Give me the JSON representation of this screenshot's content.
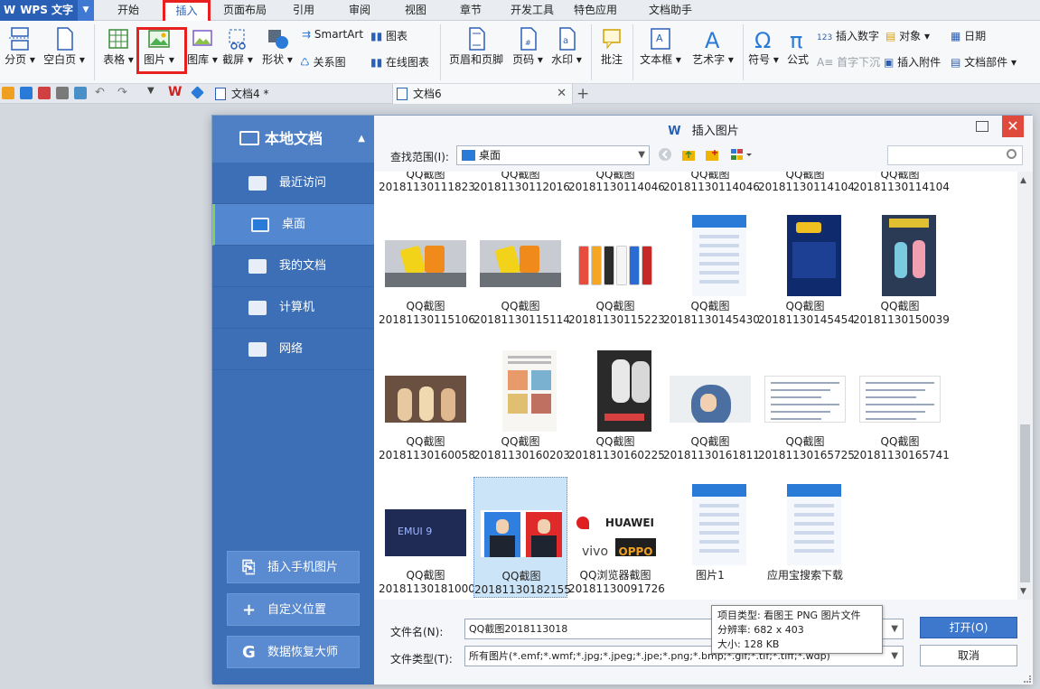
{
  "app": {
    "logo": "WPS 文字"
  },
  "menu": [
    {
      "label": "开始",
      "active": false
    },
    {
      "label": "插入",
      "active": true
    },
    {
      "label": "页面布局",
      "active": false
    },
    {
      "label": "引用",
      "active": false
    },
    {
      "label": "审阅",
      "active": false
    },
    {
      "label": "视图",
      "active": false
    },
    {
      "label": "章节",
      "active": false
    },
    {
      "label": "开发工具",
      "active": false
    },
    {
      "label": "特色应用",
      "active": false
    },
    {
      "label": "文档助手",
      "active": false
    }
  ],
  "ribbon": {
    "page_break": "分页",
    "blank_page": "空白页",
    "table": "表格",
    "picture": "图片",
    "gallery": "图库",
    "screenshot": "截屏",
    "shape": "形状",
    "smartart": "SmartArt",
    "chart": "图表",
    "relation_chart": "关系图",
    "online_chart": "在线图表",
    "header_footer": "页眉和页脚",
    "page_number": "页码",
    "watermark": "水印",
    "comment": "批注",
    "textbox": "文本框",
    "wordart": "艺术字",
    "symbol": "符号",
    "formula": "公式",
    "insert_number": "插入数字",
    "object": "对象",
    "date": "日期",
    "drop_cap": "首字下沉",
    "attachment": "插入附件",
    "doc_parts": "文档部件"
  },
  "doc_tabs": [
    {
      "label": "文档4 *",
      "active": false
    },
    {
      "label": "文档6",
      "active": true
    }
  ],
  "dialog": {
    "title": "插入图片",
    "side_header": "本地文档",
    "side_items": [
      {
        "label": "最近访问",
        "selected": false
      },
      {
        "label": "桌面",
        "selected": true
      },
      {
        "label": "我的文档",
        "selected": false
      },
      {
        "label": "计算机",
        "selected": false
      },
      {
        "label": "网络",
        "selected": false
      }
    ],
    "side_buttons": [
      {
        "label": "插入手机图片",
        "icon": "phone-icon"
      },
      {
        "label": "自定义位置",
        "icon": "plus-icon"
      },
      {
        "label": "数据恢复大师",
        "icon": "recovery-icon"
      }
    ],
    "look_in_label": "查找范围(I):",
    "look_in_value": "桌面",
    "files_row0": [
      {
        "n1": "QQ截图",
        "n2": "20181130111823"
      },
      {
        "n1": "QQ截图",
        "n2": "20181130112016"
      },
      {
        "n1": "QQ截图",
        "n2": "20181130114046"
      },
      {
        "n1": "QQ截图",
        "n2": "20181130114046"
      },
      {
        "n1": "QQ截图",
        "n2": "20181130114104"
      },
      {
        "n1": "QQ截图",
        "n2": "20181130114104"
      }
    ],
    "files": [
      {
        "n1": "QQ截图",
        "n2": "20181130115106",
        "thumb": "yellow-phones"
      },
      {
        "n1": "QQ截图",
        "n2": "20181130115114",
        "thumb": "yellow-phones"
      },
      {
        "n1": "QQ截图",
        "n2": "20181130115223",
        "thumb": "color-phones"
      },
      {
        "n1": "QQ截图",
        "n2": "20181130145430",
        "thumb": "app-screen"
      },
      {
        "n1": "QQ截图",
        "n2": "20181130145454",
        "thumb": "dark-app"
      },
      {
        "n1": "QQ截图",
        "n2": "20181130150039",
        "thumb": "poster"
      },
      {
        "n1": "QQ截图",
        "n2": "20181130160058",
        "thumb": "figurines"
      },
      {
        "n1": "QQ截图",
        "n2": "20181130160203",
        "thumb": "article"
      },
      {
        "n1": "QQ截图",
        "n2": "20181130160225",
        "thumb": "movie-poster"
      },
      {
        "n1": "QQ截图",
        "n2": "20181130161811",
        "thumb": "person-pillow"
      },
      {
        "n1": "QQ截图",
        "n2": "20181130165725",
        "thumb": "document"
      },
      {
        "n1": "QQ截图",
        "n2": "20181130165741",
        "thumb": "document"
      },
      {
        "n1": "QQ截图",
        "n2": "20181130181000",
        "thumb": "emui"
      },
      {
        "n1": "QQ截图",
        "n2": "20181130182155",
        "thumb": "id-photos",
        "selected": true
      },
      {
        "n1": "QQ浏览器截图",
        "n2": "20181130091726",
        "thumb": "brands"
      },
      {
        "n1": "图片1",
        "n2": "",
        "thumb": "app-screen"
      },
      {
        "n1": "应用宝搜索下载",
        "n2": "",
        "thumb": "app-screen"
      }
    ],
    "emui_text": "EMUI 9",
    "brand_huawei": "HUAWEI",
    "brand_vivo": "vivo",
    "brand_oppo": "OPPO",
    "filename_label": "文件名(N):",
    "filename_value": "QQ截图2018113018",
    "filetype_label": "文件类型(T):",
    "filetype_value": "所有图片(*.emf;*.wmf;*.jpg;*.jpeg;*.jpe;*.png;*.bmp;*.gif;*.tif;*.tiff;*.wdp)",
    "open_label": "打开(O)",
    "cancel_label": "取消",
    "tooltip": {
      "type": "项目类型: 看图王 PNG 图片文件",
      "resolution": "分辨率: 682 x 403",
      "size": "大小: 128 KB"
    }
  },
  "colors": {
    "accent": "#2a5fb6",
    "highlight_box": "#e8201f",
    "sidebar": "#3d6fb6"
  }
}
